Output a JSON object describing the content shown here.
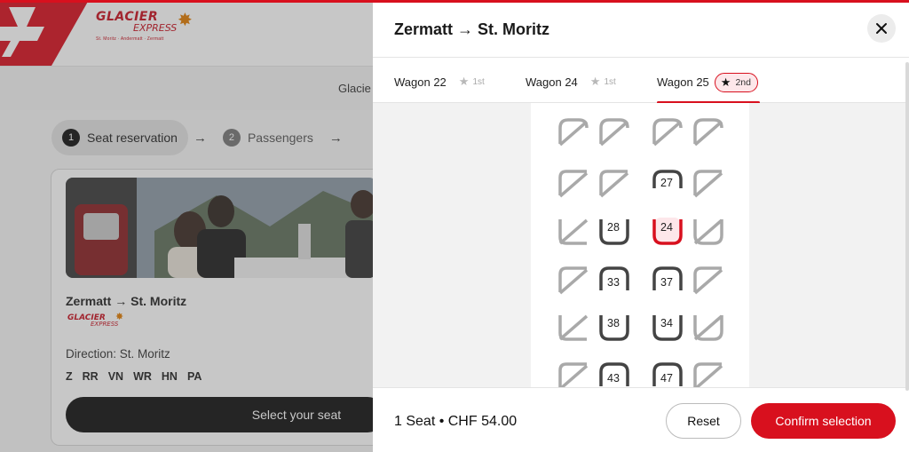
{
  "background": {
    "logo": {
      "word1": "GLACIER",
      "word2": "EXPRESS",
      "subline": "St. Moritz · Andermatt · Zermatt"
    },
    "nav_text": "Glacie",
    "steps": [
      {
        "num": "1",
        "label": "Seat reservation"
      },
      {
        "num": "2",
        "label": "Passengers"
      }
    ],
    "trip": {
      "title": "Zermatt → St. Moritz",
      "direction": "Direction: St. Moritz",
      "codes": [
        "Z",
        "RR",
        "VN",
        "WR",
        "HN",
        "PA"
      ],
      "button": "Select your seat"
    }
  },
  "panel": {
    "title": "Zermatt → St. Moritz",
    "tabs": [
      {
        "label": "Wagon 22",
        "class": "1st"
      },
      {
        "label": "Wagon 24",
        "class": "1st"
      },
      {
        "label": "Wagon 25",
        "class": "2nd"
      }
    ],
    "seats": {
      "row2_c": "27",
      "row3_b": "28",
      "row3_c": "24",
      "row4_b": "33",
      "row4_c": "37",
      "row5_b": "38",
      "row5_c": "34",
      "row6_b": "43",
      "row6_c": "47"
    },
    "footer": {
      "summary": "1 Seat • CHF 54.00",
      "reset": "Reset",
      "confirm": "Confirm selection"
    }
  },
  "colors": {
    "accent": "#d8101e",
    "selected_seat_fill": "#fde7ea"
  }
}
